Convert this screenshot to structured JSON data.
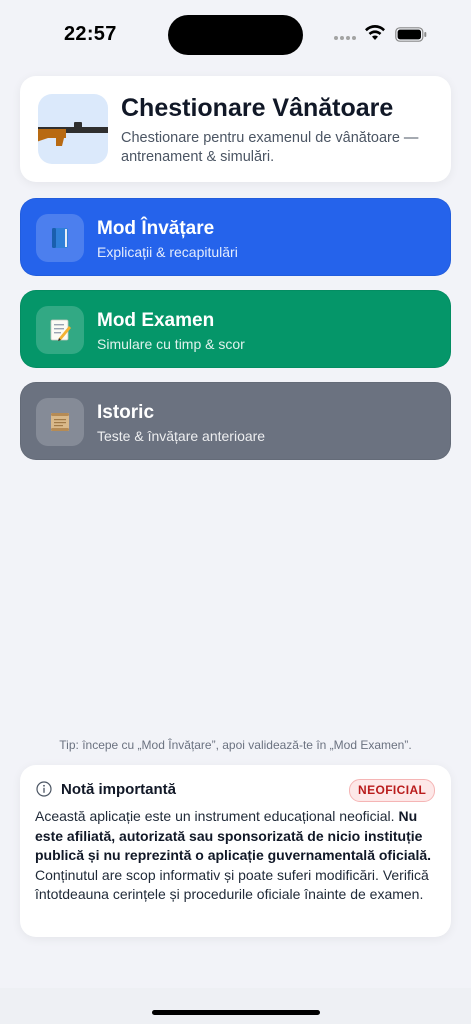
{
  "status_bar": {
    "time": "22:57"
  },
  "header": {
    "title": "Chestionare Vânătoare",
    "subtitle": "Chestionare pentru examenul de vânătoare — antrenament & simulări."
  },
  "modes": [
    {
      "title": "Mod Învățare",
      "subtitle": "Explicații & recapitulări",
      "icon": "book-icon",
      "color": "#2563eb"
    },
    {
      "title": "Mod Examen",
      "subtitle": "Simulare cu timp & scor",
      "icon": "memo-icon",
      "color": "#059669"
    },
    {
      "title": "Istoric",
      "subtitle": "Teste & învățare anterioare",
      "icon": "scroll-icon",
      "color": "#6b7280"
    }
  ],
  "tip": "Tip: începe cu „Mod Învățare”, apoi validează-te în „Mod Examen”.",
  "note": {
    "title": "Notă importantă",
    "badge": "NEOFICIAL",
    "text_1": "Această aplicație este un instrument educațional neoficial. ",
    "text_bold": "Nu este afiliată, autorizată sau sponsorizată de nicio instituție publică și nu reprezintă o aplicație guvernamentală oficială.",
    "text_2": " Conținutul are scop informativ și poate suferi modificări. Verifică întotdeauna cerințele și procedurile oficiale înainte de examen."
  }
}
